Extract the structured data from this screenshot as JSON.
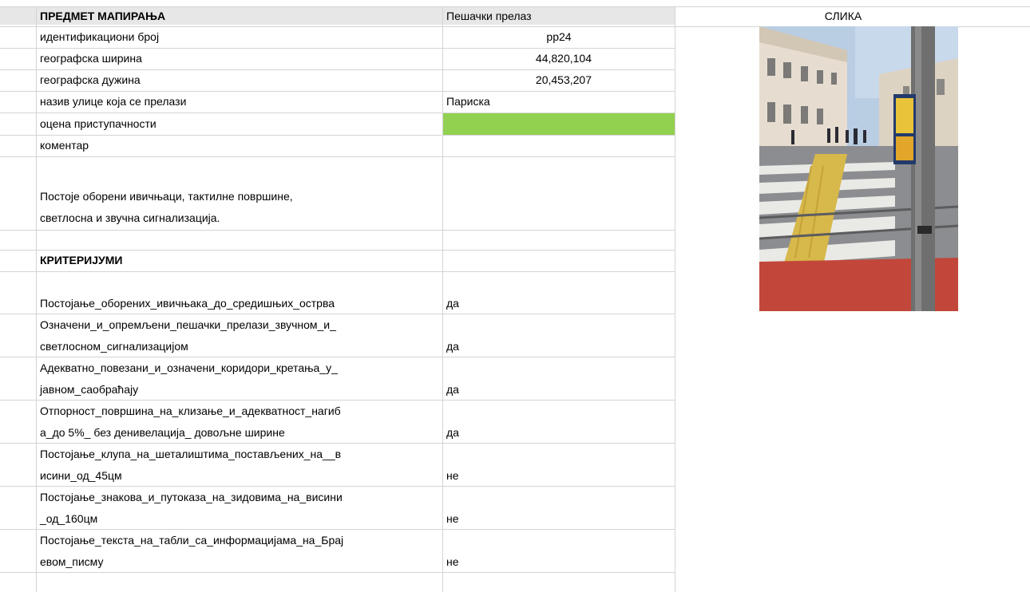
{
  "header": {
    "subject_label": "ПРЕДМЕТ МАПИРАЊА",
    "subject_value": "Пешачки прелаз",
    "image_label": "СЛИКА"
  },
  "fields": [
    {
      "label": "идентификациони број",
      "value": "pp24"
    },
    {
      "label": "географска ширина",
      "value": "44,820,104"
    },
    {
      "label": "географска дужина",
      "value": "20,453,207"
    },
    {
      "label": "назив улице која се прелази",
      "value": "Париска"
    },
    {
      "label": "оцена приступачности",
      "value": ""
    },
    {
      "label": "коментар",
      "value": ""
    }
  ],
  "rating_color": "#92d050",
  "comment_lines": [
    "Постоје оборени ивичњаци, тактилне површине,",
    "светлосна и звучна сигнализација."
  ],
  "criteria_title": "КРИТЕРИЈУМИ",
  "criteria": [
    {
      "lines": [
        "Постојање_оборених_ивичњака_до_средишњих_острва"
      ],
      "answer": "да"
    },
    {
      "lines": [
        "Означени_и_опремљени_пешачки_прелази_звучном_и_",
        "светлосном_сигнализацијом"
      ],
      "answer": "да"
    },
    {
      "lines": [
        "Адекватно_повезани_и_означени_коридори_кретања_у_",
        "јавном_саобраћају"
      ],
      "answer": "да"
    },
    {
      "lines": [
        "Отпорност_површина_на_клизање_и_адекватност_нагиб",
        "а_до 5%_ без денивелација_ довољне ширине"
      ],
      "answer": "да"
    },
    {
      "lines": [
        "Постојање_клупа_на_шеталиштима_постављених_на__в",
        "исини_од_45цм"
      ],
      "answer": "не"
    },
    {
      "lines": [
        "Постојање_знакова_и_путоказа_на_зидовима_на_висини",
        "_од_160цм"
      ],
      "answer": "не"
    },
    {
      "lines": [
        "Постојање_текста_на_табли_са_информацијама_на_Брај",
        "евом_писму"
      ],
      "answer": "не"
    }
  ],
  "photo_icon": "crosswalk-photo"
}
